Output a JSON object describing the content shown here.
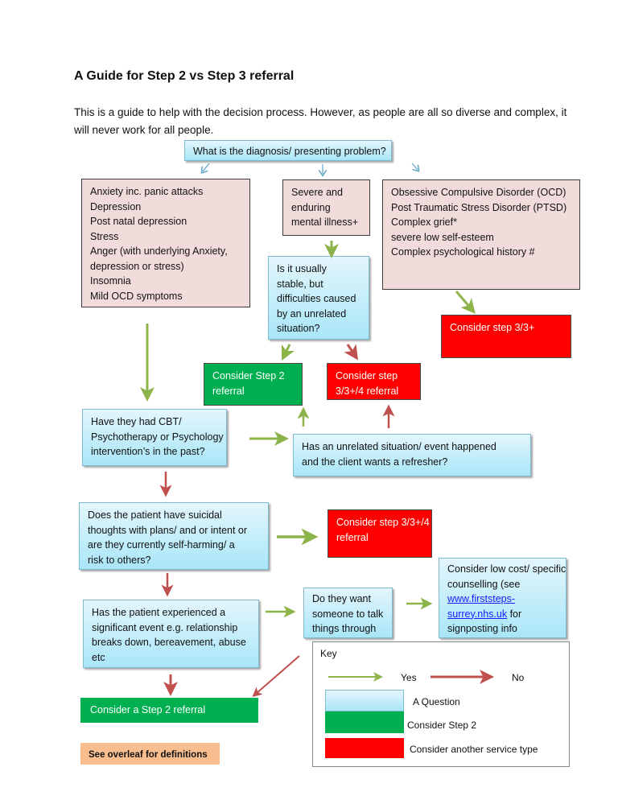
{
  "title": "A Guide for Step 2 vs Step 3 referral",
  "intro": "This is a guide to help with the decision process. However, as people are all so diverse and complex, it will never work for all people.",
  "flowchart": {
    "start_question": "What is the diagnosis/ presenting problem?",
    "left_conditions": [
      "Anxiety inc. panic attacks",
      "Depression",
      "Post natal depression",
      "Stress",
      "Anger (with underlying Anxiety,",
      "depression or stress)",
      "Insomnia",
      "Mild OCD symptoms"
    ],
    "middle_condition": [
      "Severe and",
      "enduring",
      "mental illness+"
    ],
    "right_conditions": [
      "Obsessive Compulsive Disorder (OCD)",
      "Post Traumatic Stress Disorder (PTSD)",
      "Complex grief*",
      "severe low self-esteem",
      "Complex psychological history #"
    ],
    "stable_question": [
      "Is it usually",
      "stable, but",
      "difficulties caused",
      "by an unrelated",
      "situation?"
    ],
    "consider_step3_right": "Consider step 3/3+",
    "consider_step2_mid": [
      "Consider Step 2",
      "referral"
    ],
    "consider_step34_mid": [
      "Consider step",
      "3/3+/4 referral"
    ],
    "cbt_question": [
      "Have they had CBT/",
      "Psychotherapy or Psychology",
      "intervention’s in the past?"
    ],
    "refresher_question": [
      "Has an unrelated situation/ event happened",
      "and the client wants a refresher?"
    ],
    "suicidal_question": [
      "Does the patient have suicidal",
      "thoughts with plans/ and or intent or",
      "are they currently self-harming/ a",
      "risk to others?"
    ],
    "consider_step34_lower": [
      "Consider step 3/3+/4",
      "referral"
    ],
    "event_question": [
      "Has the patient experienced a",
      "significant event e.g. relationship",
      "breaks down, bereavement, abuse",
      "etc"
    ],
    "talk_question": [
      "Do they want",
      "someone to talk",
      "things through"
    ],
    "counselling": {
      "line1": "Consider low cost/ specific",
      "line2": "counselling (see",
      "link_part1": "www.firststeps-",
      "link_part2": "surrey.nhs.uk",
      "line4_suffix": " for",
      "line5": "signposting info"
    },
    "consider_step2_bottom": "Consider a Step 2 referral",
    "overleaf_note": "See overleaf for definitions"
  },
  "key": {
    "title": "Key",
    "yes": "Yes",
    "no": "No",
    "question": "A Question",
    "step2": "Consider Step 2",
    "other": "Consider another service type"
  },
  "colors": {
    "yes_arrow": "#8db44a",
    "no_arrow": "#c0504d",
    "start_arrow": "#5ba3c9",
    "question_fill": "#bdeafa",
    "step2_green": "#00b050",
    "other_red": "#ff0000",
    "condition_pink": "#f2dcdb",
    "note_orange": "#f9be8f"
  }
}
